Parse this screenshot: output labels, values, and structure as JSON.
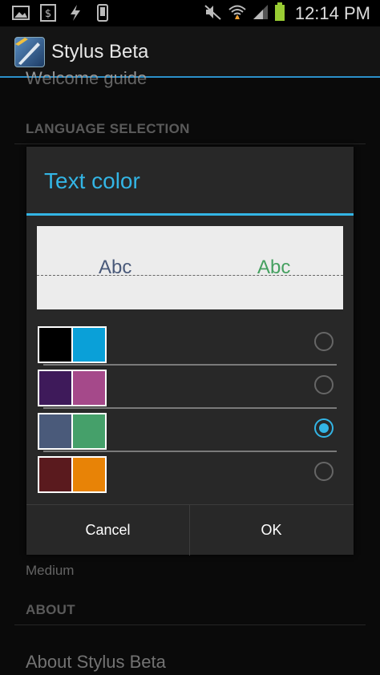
{
  "status_bar": {
    "time": "12:14 PM",
    "icons_left": [
      "image-icon",
      "dollar-doc-icon",
      "flash-icon",
      "phone-icon"
    ],
    "icons_right": [
      "mute-icon",
      "wifi-icon",
      "signal-icon",
      "battery-icon"
    ]
  },
  "action_bar": {
    "title": "Stylus Beta"
  },
  "background_list": {
    "welcome_item": "Welcome guide",
    "language_category": "LANGUAGE SELECTION",
    "medium_value": "Medium",
    "about_category": "ABOUT",
    "about_item": "About Stylus Beta"
  },
  "dialog": {
    "title": "Text color",
    "preview": {
      "left_text": "Abc",
      "right_text": "Abc",
      "left_color": "#4a5a7a",
      "right_color": "#45a060"
    },
    "options": [
      {
        "colors": [
          "#000000",
          "#0aa0d8"
        ],
        "selected": false
      },
      {
        "colors": [
          "#3e1a5a",
          "#a5498a"
        ],
        "selected": false
      },
      {
        "colors": [
          "#4a5a7a",
          "#45a06a"
        ],
        "selected": true
      },
      {
        "colors": [
          "#5a1a1e",
          "#e88306"
        ],
        "selected": false
      }
    ],
    "cancel_label": "Cancel",
    "ok_label": "OK"
  },
  "accent_color": "#33b5e5"
}
